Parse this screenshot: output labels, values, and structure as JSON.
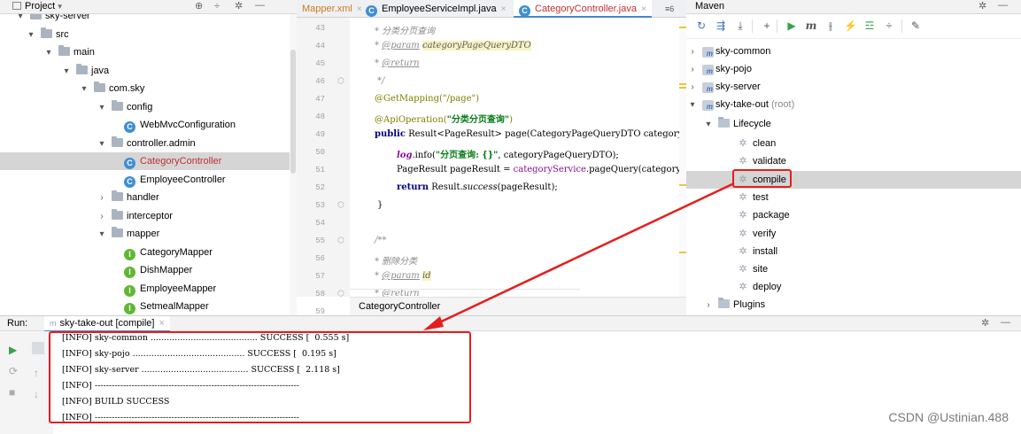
{
  "project_panel": {
    "title": "Project",
    "tree": [
      {
        "label": "sky-server",
        "kind": "folder",
        "level": 0,
        "chevron": "▾"
      },
      {
        "label": "src",
        "kind": "folder",
        "level": 1,
        "chevron": "▾"
      },
      {
        "label": "main",
        "kind": "folder",
        "level": 2,
        "chevron": "▾"
      },
      {
        "label": "java",
        "kind": "folder",
        "level": 3,
        "chevron": "▾"
      },
      {
        "label": "com.sky",
        "kind": "folder",
        "level": 4,
        "chevron": "▾"
      },
      {
        "label": "config",
        "kind": "folder",
        "level": 5,
        "chevron": "▾"
      },
      {
        "label": "WebMvcConfiguration",
        "kind": "class",
        "level": 6
      },
      {
        "label": "controller.admin",
        "kind": "folder",
        "level": 5,
        "chevron": "▾"
      },
      {
        "label": "CategoryController",
        "kind": "class",
        "level": 6,
        "selected": true
      },
      {
        "label": "EmployeeController",
        "kind": "class",
        "level": 6
      },
      {
        "label": "handler",
        "kind": "folder",
        "level": 5,
        "chevron": "›"
      },
      {
        "label": "interceptor",
        "kind": "folder",
        "level": 5,
        "chevron": "›"
      },
      {
        "label": "mapper",
        "kind": "folder",
        "level": 5,
        "chevron": "▾"
      },
      {
        "label": "CategoryMapper",
        "kind": "interface",
        "level": 6
      },
      {
        "label": "DishMapper",
        "kind": "interface",
        "level": 6
      },
      {
        "label": "EmployeeMapper",
        "kind": "interface",
        "level": 6
      },
      {
        "label": "SetmealMapper",
        "kind": "interface",
        "level": 6
      }
    ]
  },
  "editor": {
    "tabs": [
      {
        "label": "Mapper.xml",
        "x": 0
      },
      {
        "label": "EmployeeServiceImpl.java",
        "active": false
      },
      {
        "label": "CategoryController.java",
        "active": true
      }
    ],
    "tab_overflow": "≡6",
    "line_numbers": [
      "43",
      "44",
      "45",
      "46",
      "47",
      "48",
      "49",
      "50",
      "51",
      "52",
      "53",
      "54",
      "55",
      "56",
      "57",
      "58",
      "59"
    ],
    "breadcrumb": "CategoryController"
  },
  "code": {
    "l43_comment": "* 分类分页查询",
    "l44_param": "@param",
    "l44_name": "categoryPageQueryDTO",
    "l45_return": "@return",
    "l46_end": "*/",
    "l47_annotation": "@GetMapping(\"/page\")",
    "l48_annotation_name": "@ApiOperation(",
    "l48_string": "\"分类分页查询\"",
    "l48_close": ")",
    "l49_kw": "public",
    "l49_rest": " Result<PageResult> page(CategoryPageQueryDTO categoryPag",
    "l50_log": "log",
    "l50_mid": ".info(",
    "l50_string": "\"分页查询: {}\"",
    "l50_rest": ", categoryPageQueryDTO);",
    "l51_start": "PageResult pageResult = ",
    "l51_field": "categoryService",
    "l51_rest": ".pageQuery(categoryP",
    "l52_kw": "return",
    "l52_mid": " Result.",
    "l52_method": "success",
    "l52_rest": "(pageResult);",
    "l53_brace": "}",
    "l55_doc": "/**",
    "l56_comment": "* 删除分类",
    "l57_param": "@param",
    "l57_name": "id",
    "l58_return": "@return",
    "l59_end": "*/"
  },
  "maven_panel": {
    "title": "Maven",
    "toolbar_icons": [
      "refresh-icon",
      "reimport-icon",
      "download-icon",
      "add-icon",
      "run-icon",
      "execute-goal-icon",
      "skip-tests-icon",
      "offline-icon",
      "show-dependencies-icon",
      "collapse-icon",
      "settings-wrench-icon"
    ],
    "modules": [
      "sky-common",
      "sky-pojo",
      "sky-server",
      "sky-take-out"
    ],
    "root_tag": "(root)",
    "lifecycle_label": "Lifecycle",
    "lifecycle": [
      "clean",
      "validate",
      "compile",
      "test",
      "package",
      "verify",
      "install",
      "site",
      "deploy"
    ],
    "selected_phase": "compile",
    "plugins_label": "Plugins"
  },
  "run_panel": {
    "label": "Run:",
    "tab": "sky-take-out [compile]",
    "output": [
      "[INFO] sky-common ........................................ SUCCESS [  0.555 s]",
      "[INFO] sky-pojo .......................................... SUCCESS [  0.195 s]",
      "[INFO] sky-server ........................................ SUCCESS [  2.118 s]",
      "[INFO] ------------------------------------------------------------------------",
      "[INFO] BUILD SUCCESS",
      "[INFO] ------------------------------------------------------------------------"
    ]
  },
  "watermark": "CSDN @Ustinian.488",
  "colors": {
    "highlight_red": "#e41e1e",
    "selection": "#d5d5d5",
    "accent_blue": "#3f8ed8"
  }
}
